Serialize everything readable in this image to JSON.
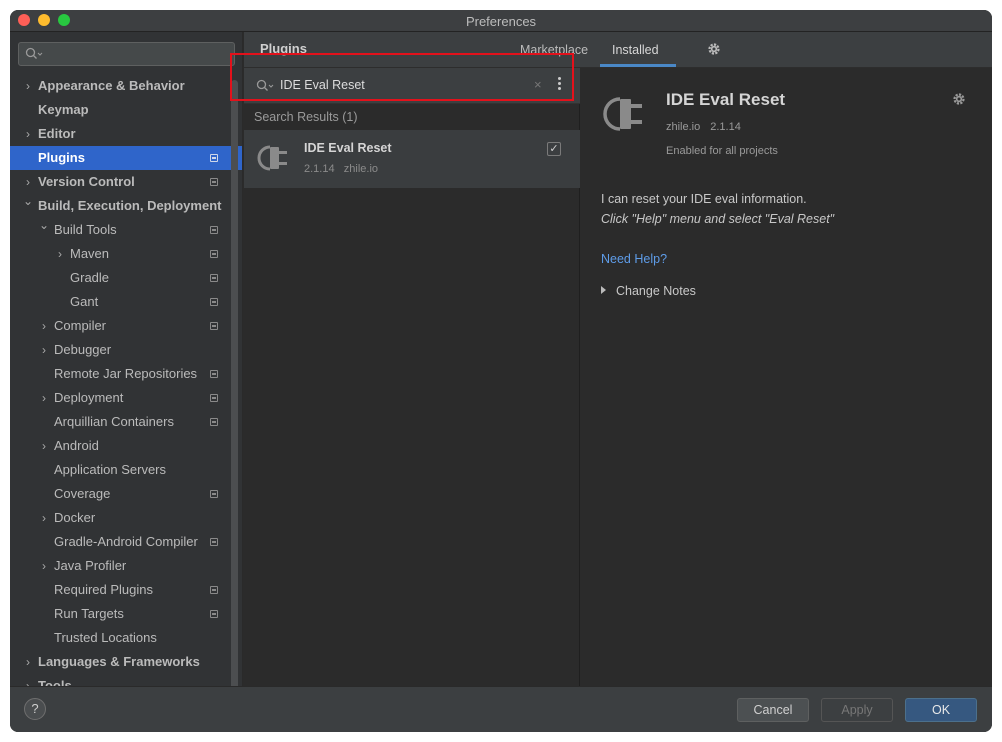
{
  "window": {
    "title": "Preferences"
  },
  "sidebar": {
    "search_value": "",
    "items": [
      {
        "label": "Appearance & Behavior",
        "level": 0,
        "chevron": "right",
        "bold": true,
        "proj": false,
        "selected": false
      },
      {
        "label": "Keymap",
        "level": 0,
        "chevron": "",
        "bold": true,
        "proj": false,
        "selected": false
      },
      {
        "label": "Editor",
        "level": 0,
        "chevron": "right",
        "bold": true,
        "proj": false,
        "selected": false
      },
      {
        "label": "Plugins",
        "level": 0,
        "chevron": "",
        "bold": true,
        "proj": true,
        "selected": true
      },
      {
        "label": "Version Control",
        "level": 0,
        "chevron": "right",
        "bold": true,
        "proj": true,
        "selected": false
      },
      {
        "label": "Build, Execution, Deployment",
        "level": 0,
        "chevron": "down",
        "bold": true,
        "proj": false,
        "selected": false
      },
      {
        "label": "Build Tools",
        "level": 1,
        "chevron": "down",
        "bold": false,
        "proj": true,
        "selected": false
      },
      {
        "label": "Maven",
        "level": 2,
        "chevron": "right",
        "bold": false,
        "proj": true,
        "selected": false
      },
      {
        "label": "Gradle",
        "level": 2,
        "chevron": "",
        "bold": false,
        "proj": true,
        "selected": false
      },
      {
        "label": "Gant",
        "level": 2,
        "chevron": "",
        "bold": false,
        "proj": true,
        "selected": false
      },
      {
        "label": "Compiler",
        "level": 1,
        "chevron": "right",
        "bold": false,
        "proj": true,
        "selected": false
      },
      {
        "label": "Debugger",
        "level": 1,
        "chevron": "right",
        "bold": false,
        "proj": false,
        "selected": false
      },
      {
        "label": "Remote Jar Repositories",
        "level": 1,
        "chevron": "",
        "bold": false,
        "proj": true,
        "selected": false
      },
      {
        "label": "Deployment",
        "level": 1,
        "chevron": "right",
        "bold": false,
        "proj": true,
        "selected": false
      },
      {
        "label": "Arquillian Containers",
        "level": 1,
        "chevron": "",
        "bold": false,
        "proj": true,
        "selected": false
      },
      {
        "label": "Android",
        "level": 1,
        "chevron": "right",
        "bold": false,
        "proj": false,
        "selected": false
      },
      {
        "label": "Application Servers",
        "level": 1,
        "chevron": "",
        "bold": false,
        "proj": false,
        "selected": false
      },
      {
        "label": "Coverage",
        "level": 1,
        "chevron": "",
        "bold": false,
        "proj": true,
        "selected": false
      },
      {
        "label": "Docker",
        "level": 1,
        "chevron": "right",
        "bold": false,
        "proj": false,
        "selected": false
      },
      {
        "label": "Gradle-Android Compiler",
        "level": 1,
        "chevron": "",
        "bold": false,
        "proj": true,
        "selected": false
      },
      {
        "label": "Java Profiler",
        "level": 1,
        "chevron": "right",
        "bold": false,
        "proj": false,
        "selected": false
      },
      {
        "label": "Required Plugins",
        "level": 1,
        "chevron": "",
        "bold": false,
        "proj": true,
        "selected": false
      },
      {
        "label": "Run Targets",
        "level": 1,
        "chevron": "",
        "bold": false,
        "proj": true,
        "selected": false
      },
      {
        "label": "Trusted Locations",
        "level": 1,
        "chevron": "",
        "bold": false,
        "proj": false,
        "selected": false
      },
      {
        "label": "Languages & Frameworks",
        "level": 0,
        "chevron": "right",
        "bold": true,
        "proj": false,
        "selected": false
      },
      {
        "label": "Tools",
        "level": 0,
        "chevron": "right",
        "bold": true,
        "proj": false,
        "selected": false
      }
    ]
  },
  "plugins": {
    "title": "Plugins",
    "tabs": {
      "marketplace": "Marketplace",
      "installed": "Installed"
    },
    "search_value": "IDE Eval Reset",
    "search_clear": "×",
    "results_header": "Search Results (1)",
    "result": {
      "name": "IDE Eval Reset",
      "version": "2.1.14",
      "vendor": "zhile.io",
      "check": "✓"
    }
  },
  "detail": {
    "name": "IDE Eval Reset",
    "vendor": "zhile.io",
    "version": "2.1.14",
    "status": "Enabled for all projects",
    "desc_line1": "I can reset your IDE eval information.",
    "desc_line2": "Click \"Help\" menu and select \"Eval Reset\"",
    "help_link": "Need Help?",
    "change_notes": "Change Notes"
  },
  "footer": {
    "help": "?",
    "cancel": "Cancel",
    "apply": "Apply",
    "ok": "OK"
  },
  "colors": {
    "accent": "#2f65ca",
    "highlight": "#e3111b",
    "link": "#5e9ce8",
    "ok_button": "#365880"
  }
}
